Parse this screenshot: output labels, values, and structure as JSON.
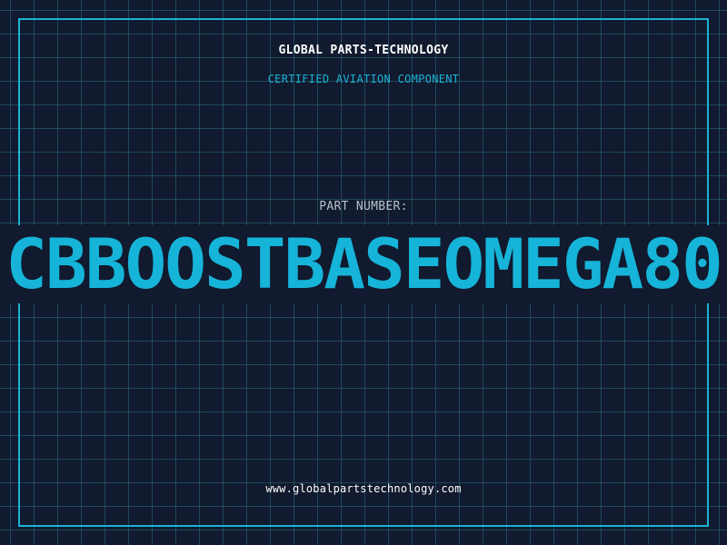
{
  "header": {
    "title": "GLOBAL PARTS-TECHNOLOGY",
    "subtitle": "CERTIFIED AVIATION COMPONENT"
  },
  "part": {
    "label": "PART NUMBER:",
    "number": "CBBOOSTBASEOMEGA80"
  },
  "footer": {
    "url": "www.globalpartstechnology.com"
  },
  "colors": {
    "background": "#111a2e",
    "accent": "#1bb3d6",
    "grid": "#286e82",
    "label": "#b7c1cc",
    "text": "#ffffff"
  }
}
